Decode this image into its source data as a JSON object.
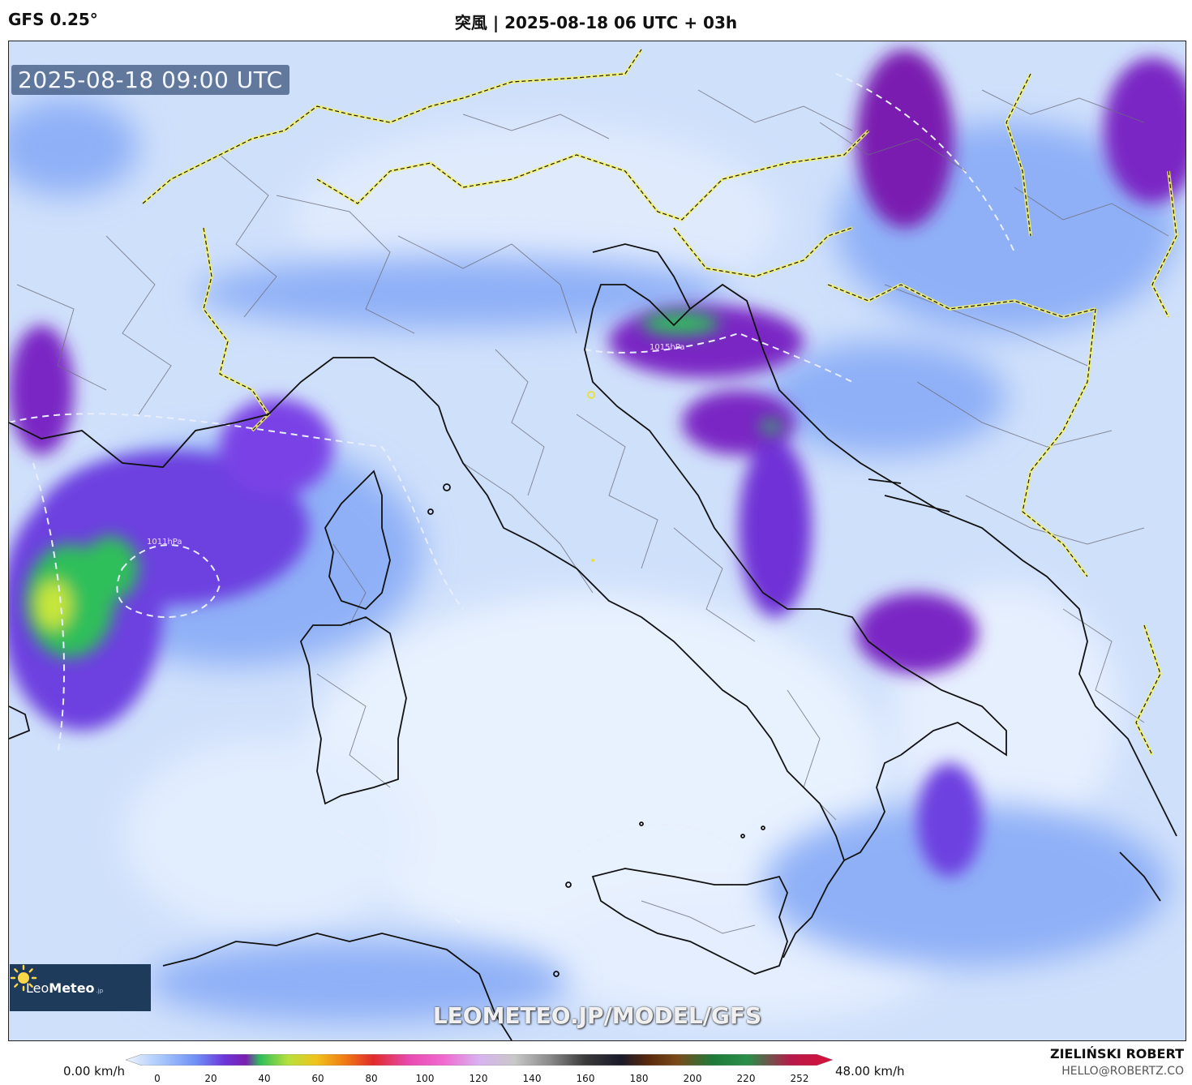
{
  "header": {
    "model": "GFS 0.25°",
    "title": "突風 | 2025-08-18 06 UTC + 03h"
  },
  "map": {
    "timestamp": "2025-08-18 09:00 UTC",
    "isobars": [
      "1015hPa",
      "1011hPa"
    ],
    "watermark": "LEOMETEO.JP/MODEL/GFS",
    "logo": {
      "name_light": "Leo",
      "name_bold": "Meteo",
      "suffix": ".jp",
      "icon": "sun-icon"
    }
  },
  "legend": {
    "min_label": "0.00 km/h",
    "max_label": "48.00 km/h",
    "ticks": [
      "0",
      "20",
      "40",
      "60",
      "80",
      "100",
      "120",
      "140",
      "160",
      "180",
      "200",
      "220",
      "252"
    ],
    "colors": [
      "#e9f1fe",
      "#a9c8fb",
      "#6f8ff6",
      "#6c35d8",
      "#7a1fb0",
      "#2fbf5a",
      "#b8e03c",
      "#f0c21d",
      "#f07b14",
      "#e02b2b",
      "#f06ad0",
      "#d8b3f0",
      "#c8c8c8",
      "#8a8a8a",
      "#3a3a3a",
      "#1a1a2a",
      "#5a2a0a",
      "#7a4a1a",
      "#1f7a3a",
      "#2a8f4a",
      "#b51a4a",
      "#d80f3a"
    ]
  },
  "credits": {
    "author": "ZIELIŃSKI ROBERT",
    "email": "HELLO@ROBERTZ.CO"
  }
}
